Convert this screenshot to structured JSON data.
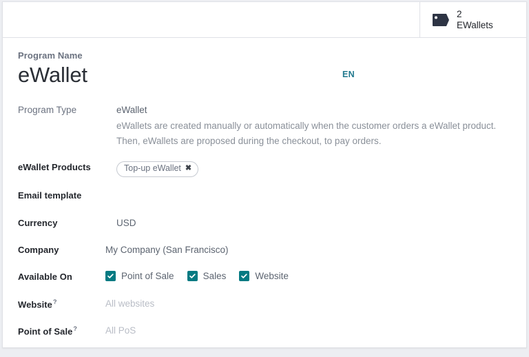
{
  "stat_button": {
    "icon": "tags-icon",
    "value": "2",
    "label": "EWallets"
  },
  "title": {
    "label": "Program Name",
    "value": "eWallet"
  },
  "language_badge": "EN",
  "fields": {
    "program_type": {
      "label": "Program Type",
      "value": "eWallet",
      "description_line1": "eWallets are created manually or automatically when the customer orders a eWallet product.",
      "description_line2": "Then, eWallets are proposed during the checkout, to pay orders."
    },
    "ewallet_products": {
      "label": "eWallet Products",
      "tags": [
        {
          "text": "Top-up eWallet",
          "remove": "✖"
        }
      ]
    },
    "email_template": {
      "label": "Email template",
      "value": ""
    },
    "currency": {
      "label": "Currency",
      "value": "USD"
    },
    "company": {
      "label": "Company",
      "value": "My Company (San Francisco)"
    },
    "available_on": {
      "label": "Available On",
      "options": [
        {
          "label": "Point of Sale",
          "checked": true
        },
        {
          "label": "Sales",
          "checked": true
        },
        {
          "label": "Website",
          "checked": true
        }
      ]
    },
    "website": {
      "label": "Website",
      "help": "?",
      "placeholder": "All websites"
    },
    "point_of_sale": {
      "label": "Point of Sale",
      "help": "?",
      "placeholder": "All PoS"
    }
  },
  "colors": {
    "accent_teal": "#047a82",
    "lang_badge": "#21798e",
    "stat_text": "#23262c",
    "page_bg": "#edeef2"
  }
}
